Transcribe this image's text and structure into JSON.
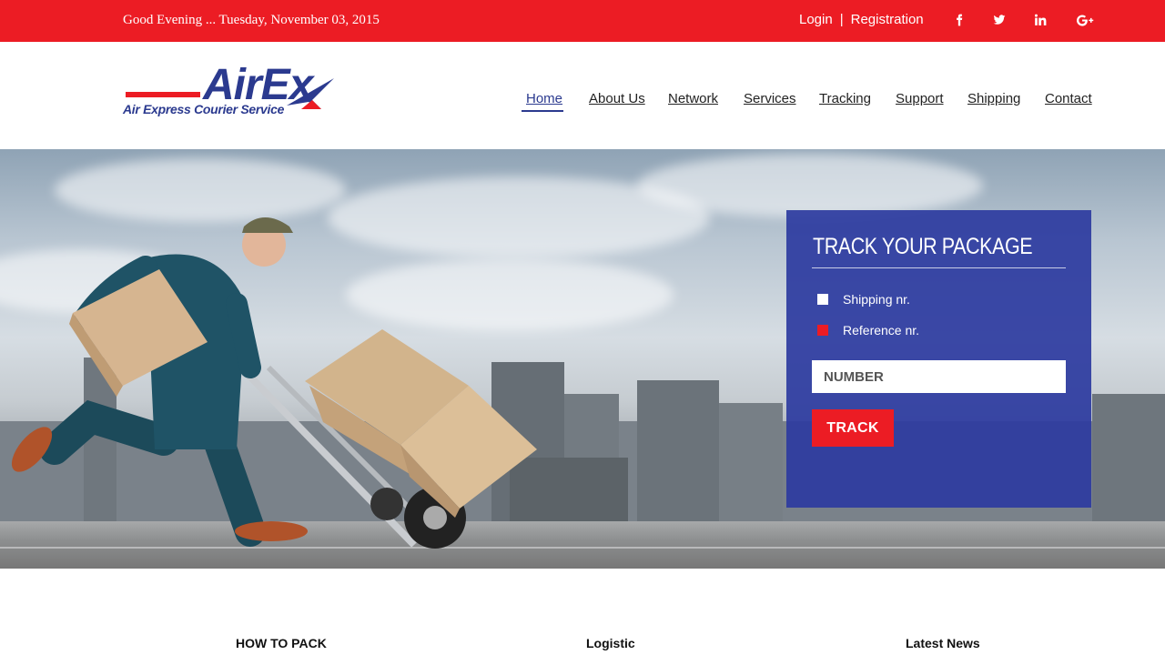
{
  "topbar": {
    "greeting": "Good Evening ... Tuesday, November 03, 2015",
    "login": "Login",
    "separator": "|",
    "registration": "Registration",
    "social_icons": [
      "facebook-icon",
      "twitter-icon",
      "linkedin-icon",
      "google-plus-icon"
    ],
    "background_color": "#ec1c24"
  },
  "logo": {
    "wordmark": "AirEx",
    "tagline": "Air Express Courier Service"
  },
  "nav": {
    "items": [
      "Home",
      "About Us",
      "Network",
      "Services",
      "Tracking",
      "Support",
      "Shipping",
      "Contact"
    ],
    "active": "Home"
  },
  "track": {
    "title": "TRACK YOUR PACKAGE",
    "options": [
      {
        "label": "Shipping nr.",
        "box_color": "#ffffff"
      },
      {
        "label": "Reference nr.",
        "box_color": "#ec1c24"
      }
    ],
    "input_placeholder": "NUMBER",
    "input_value": "",
    "button_label": "TRACK",
    "panel_color": "#2d3ba0"
  },
  "sections": [
    "HOW TO PACK",
    "Logistic",
    "Latest News"
  ]
}
